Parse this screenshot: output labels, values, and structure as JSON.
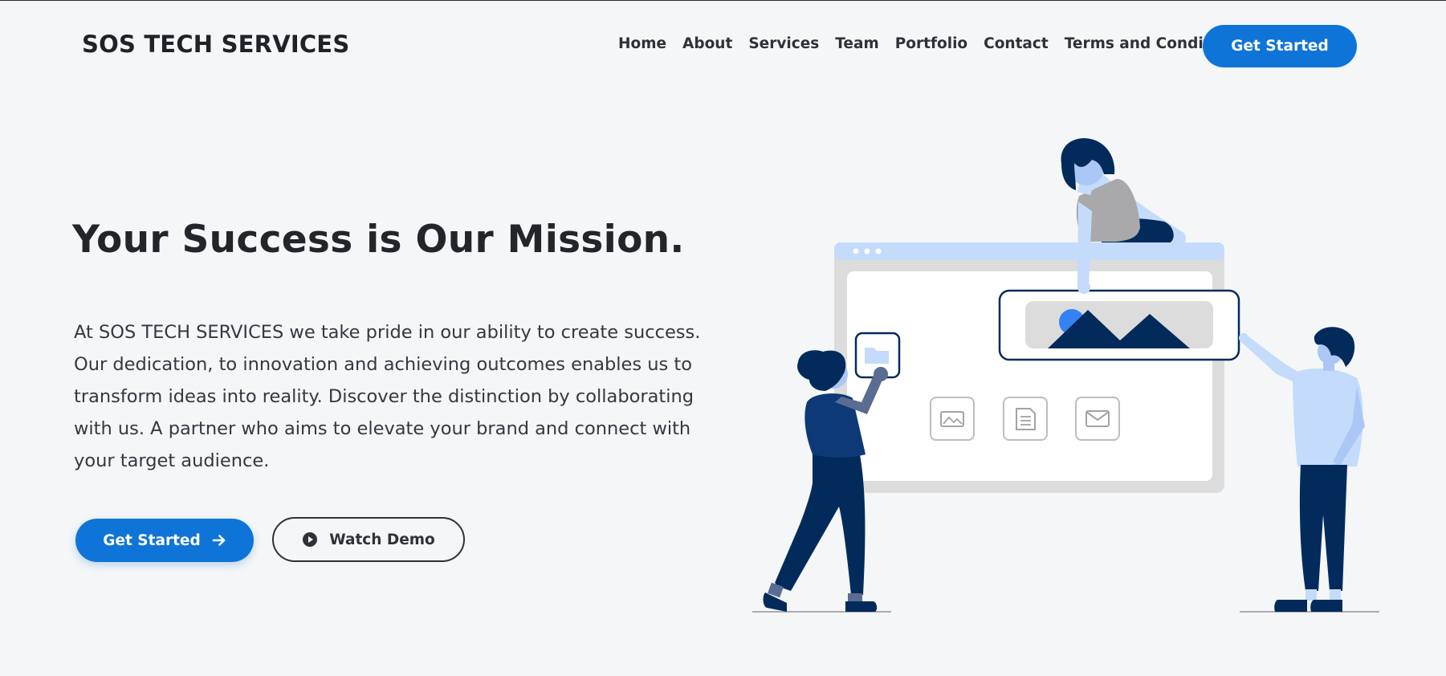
{
  "brand": {
    "name": "SOS TECH SERVICES"
  },
  "nav": {
    "items": [
      {
        "label": "Home"
      },
      {
        "label": "About"
      },
      {
        "label": "Services"
      },
      {
        "label": "Team"
      },
      {
        "label": "Portfolio"
      },
      {
        "label": "Contact"
      },
      {
        "label": "Terms and Conditions"
      }
    ],
    "cta_label": "Get Started"
  },
  "hero": {
    "title": "Your Success is Our Mission.",
    "lines": [
      "At SOS TECH SERVICES we take pride in our ability to create success.",
      "Our dedication, to innovation and achieving outcomes enables us to",
      "transform ideas into reality. Discover the distinction by collaborating",
      "with us. A partner who aims to elevate your brand and connect with",
      "your target audience."
    ],
    "primary_button": {
      "label": "Get Started",
      "icon": "arrow-right-icon"
    },
    "secondary_button": {
      "label": "Watch Demo",
      "icon": "play-circle-icon"
    }
  },
  "colors": {
    "accent": "#0f74d8",
    "dark_navy": "#022b5b",
    "light_blue": "#c4dbfb",
    "background": "#f4f6f8"
  }
}
